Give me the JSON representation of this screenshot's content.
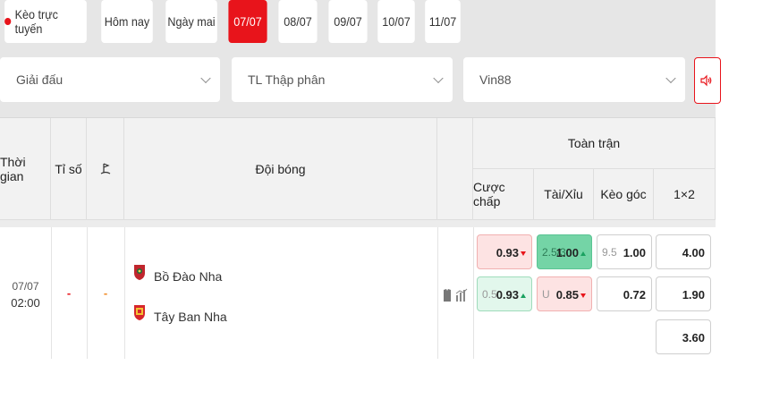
{
  "tabs": [
    {
      "label": "Kèo trực tuyến",
      "live": true
    },
    {
      "label": "Hôm nay"
    },
    {
      "label": "Ngày mai"
    },
    {
      "label": "07/07",
      "active": true
    },
    {
      "label": "08/07"
    },
    {
      "label": "09/07"
    },
    {
      "label": "10/07"
    },
    {
      "label": "11/07"
    }
  ],
  "filters": {
    "league": "Giải đấu",
    "odds_format": "TL Thập phân",
    "bookmaker": "Vin88"
  },
  "table": {
    "headers": {
      "time": "Thời gian",
      "score": "Tỉ số",
      "corner_icon": "corner-flag-icon",
      "teams": "Đội bóng",
      "full_match": "Toàn trận",
      "handicap": "Cược chấp",
      "over_under": "Tài/Xỉu",
      "corners": "Kèo góc",
      "one_x_two": "1×2"
    },
    "match": {
      "date": "07/07",
      "time": "02:00",
      "score": "-",
      "corner_score": "-",
      "home": "Bồ Đào Nha",
      "away": "Tây Ban Nha",
      "handicap": {
        "home_odds": "0.93",
        "line": "0.5",
        "away_odds": "0.93"
      },
      "over_under": {
        "line": "2.5/3",
        "over_odds": "1.00",
        "under_label": "U",
        "under_odds": "0.85"
      },
      "corners": {
        "line": "9.5",
        "over_odds": "1.00",
        "under_odds": "0.72"
      },
      "one_x_two": {
        "home": "4.00",
        "away": "1.90",
        "draw": "3.60"
      }
    }
  },
  "colors": {
    "accent": "#e8141b",
    "odds_down_bg": "#fde3e3",
    "odds_up_bg": "#e2f7ec",
    "odds_up_strong_bg": "#74d4a6"
  }
}
